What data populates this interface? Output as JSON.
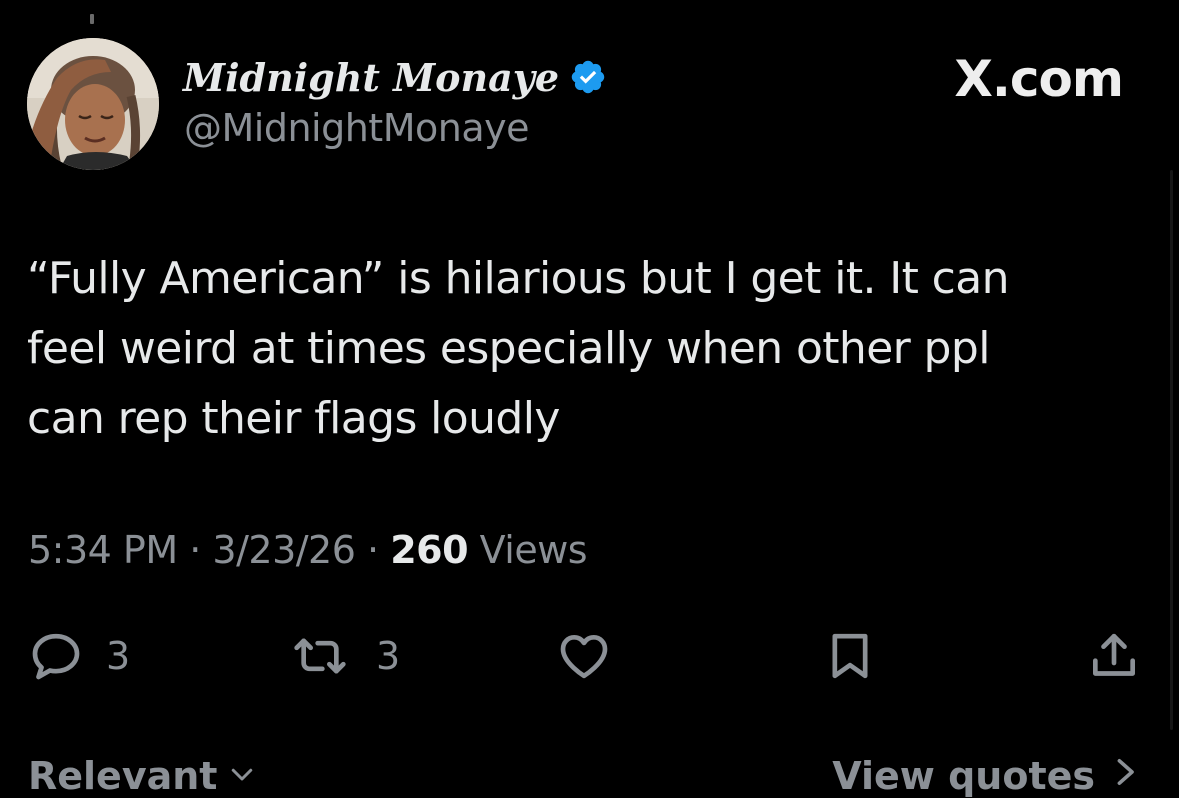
{
  "author": {
    "display_name": "Midnight Monaye",
    "handle": "@MidnightMonaye",
    "verified_icon": "verified-badge-icon",
    "avatar_icon": "profile-photo"
  },
  "brand": {
    "label": "X.com"
  },
  "tweet": {
    "lines": [
      "“Fully American” is hilarious but I get it. It can",
      "feel weird at times especially when other ppl",
      "can rep their flags loudly"
    ]
  },
  "meta": {
    "time": "5:34 PM",
    "separator": "·",
    "date": "3/23/26",
    "views_count": "260",
    "views_label": "Views"
  },
  "actions": {
    "reply": {
      "icon": "reply-icon",
      "count": "3"
    },
    "repost": {
      "icon": "repost-icon",
      "count": "3"
    },
    "like": {
      "icon": "heart-icon"
    },
    "bookmark": {
      "icon": "bookmark-icon"
    },
    "share": {
      "icon": "share-icon"
    }
  },
  "footer": {
    "sort_label": "Relevant",
    "view_quotes_label": "View quotes"
  },
  "colors": {
    "background": "#000000",
    "primary_text": "#e7e9ea",
    "secondary_text": "#8b9096",
    "verified_blue": "#1d9bf0"
  }
}
